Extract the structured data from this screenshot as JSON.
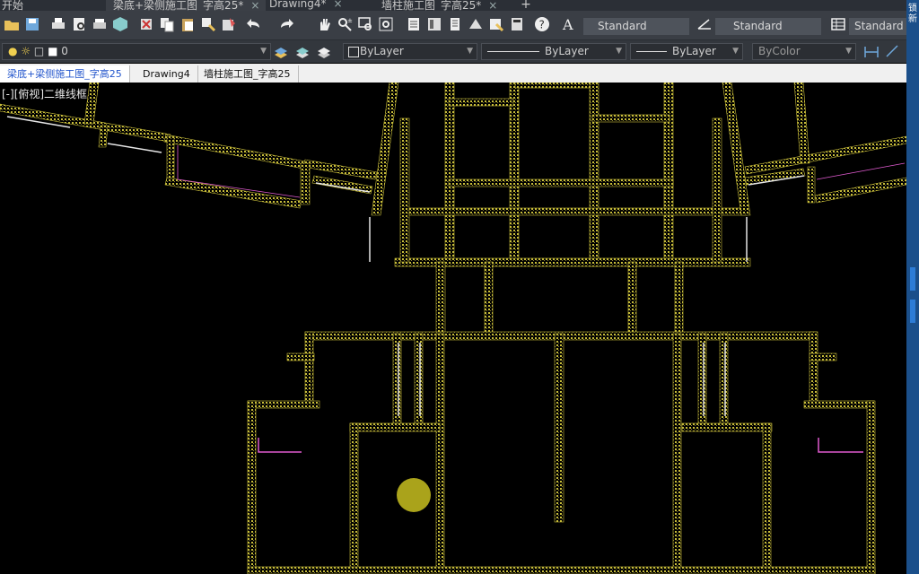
{
  "file_tabs": {
    "start": "开始",
    "tab1": "梁底+梁侧施工图_字高25*",
    "tab2": "Drawing4*",
    "tab3": "墙柱施工图_字高25*",
    "add": "+"
  },
  "toolbar": {
    "text_style": "Standard",
    "dim_style": "Standard",
    "table_style": "Standard"
  },
  "properties": {
    "layer": "0",
    "color": "ByLayer",
    "linetype": "ByLayer",
    "lineweight": "ByLayer",
    "plotstyle": "ByColor"
  },
  "doc_tabs": [
    "梁底+梁侧施工图_字高25",
    "Drawing4",
    "墙柱施工图_字高25"
  ],
  "viewport": {
    "label": "[-][俯视]二维线框"
  },
  "right_edge": {
    "t1": "锁",
    "t2": "新"
  },
  "colors": {
    "wall": "#c8bd3a",
    "wall_dark": "#8a8230",
    "accent_pink": "#e05bd0",
    "accent_white": "#e6e6e6",
    "background": "#000000"
  }
}
